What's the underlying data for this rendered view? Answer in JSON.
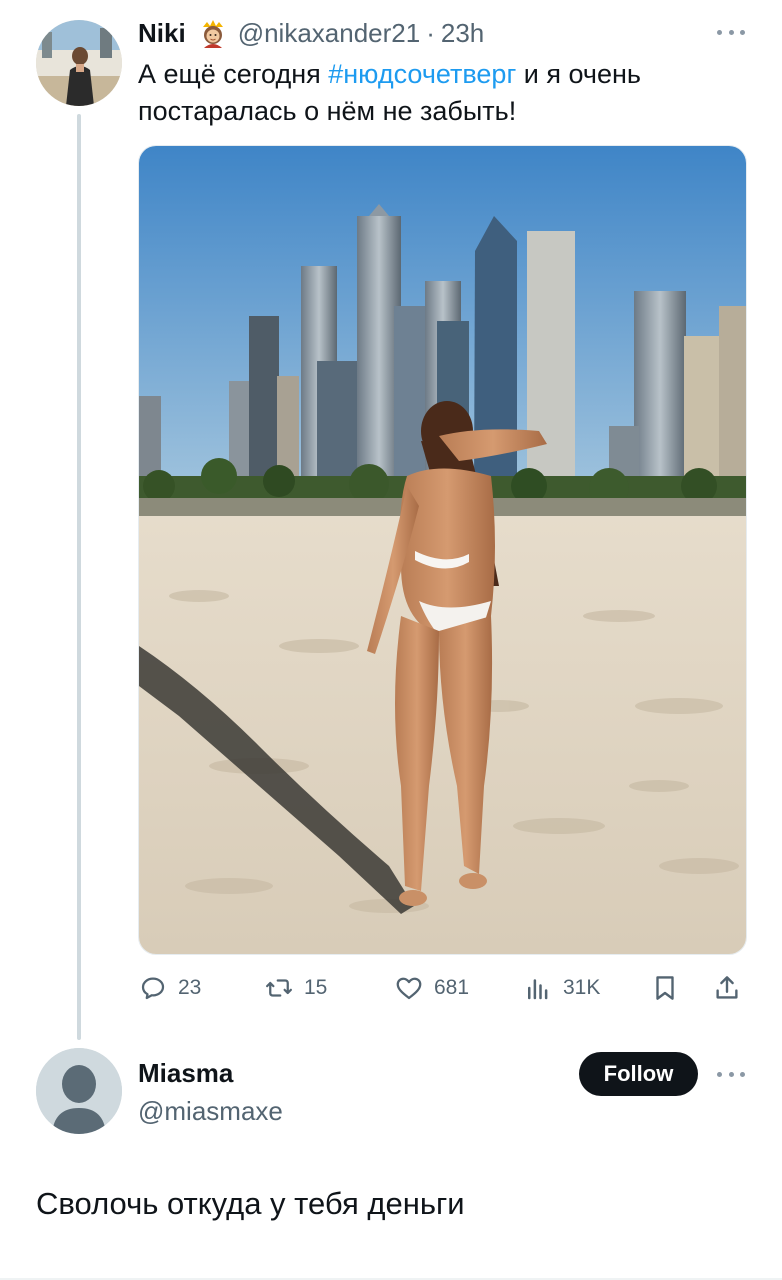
{
  "tweet": {
    "author_name": "Niki",
    "author_handle": "@nikaxander21",
    "separator": "·",
    "time": "23h",
    "text_before": "А ещё сегодня ",
    "hashtag": "#нюдсочетверг",
    "text_after": " и я очень постаралась о нём не забыть!",
    "icons": {
      "crown_emoji": "woman-with-crown-icon",
      "more": "more-icon"
    },
    "actions": {
      "replies": "23",
      "retweets": "15",
      "likes": "681",
      "views": "31K"
    }
  },
  "reply": {
    "author_name": "Miasma",
    "author_handle": "@miasmaxe",
    "follow_label": "Follow",
    "text": "Сволочь откуда у тебя деньги"
  },
  "colors": {
    "text": "#0f1419",
    "secondary": "#536471",
    "hashtag": "#1d9bf0",
    "thread_line": "#cfd9de",
    "follow_bg": "#0f1419"
  }
}
